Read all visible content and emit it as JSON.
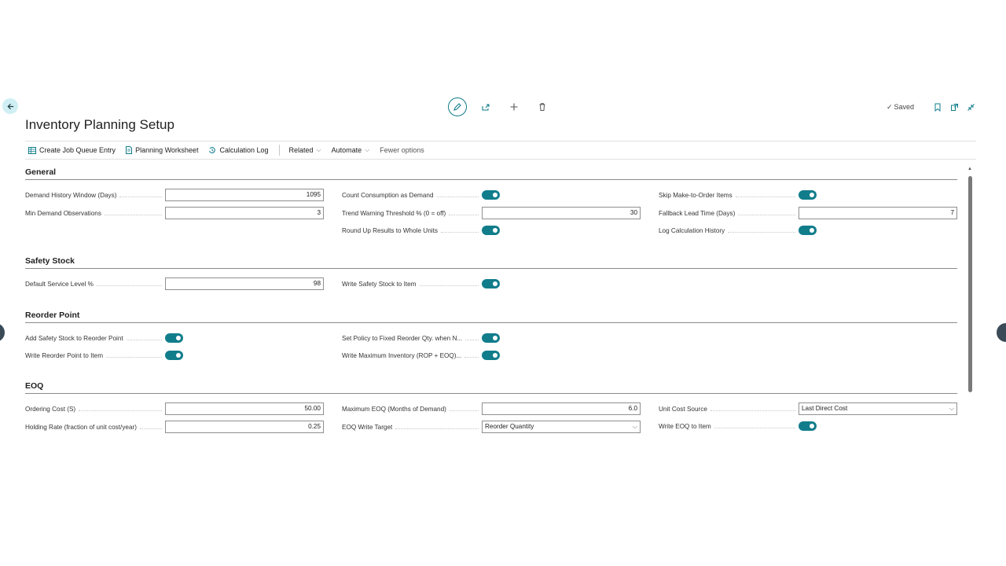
{
  "page": {
    "title": "Inventory Planning Setup",
    "status": "Saved"
  },
  "top_actions": [
    "edit-icon",
    "share-icon",
    "plus-icon",
    "delete-icon"
  ],
  "right_actions": [
    "bookmark-icon",
    "open-in-new-window-icon",
    "collapse-icon"
  ],
  "action_bar": {
    "create_job_queue": "Create Job Queue Entry",
    "planning_worksheet": "Planning Worksheet",
    "calculation_log": "Calculation Log",
    "related": "Related",
    "automate": "Automate",
    "fewer_options": "Fewer options"
  },
  "general": {
    "title": "General",
    "demand_history_window_label": "Demand History Window (Days)",
    "demand_history_window_value": "1095",
    "min_demand_observations_label": "Min Demand Observations",
    "min_demand_observations_value": "3",
    "count_consumption_label": "Count Consumption as Demand",
    "count_consumption_value": true,
    "trend_warning_label": "Trend Warning Threshold % (0 = off)",
    "trend_warning_value": "30",
    "round_up_label": "Round Up Results to Whole Units",
    "round_up_value": true,
    "skip_mto_label": "Skip Make-to-Order Items",
    "skip_mto_value": true,
    "fallback_lead_time_label": "Fallback Lead Time (Days)",
    "fallback_lead_time_value": "7",
    "log_history_label": "Log Calculation History",
    "log_history_value": true
  },
  "safety_stock": {
    "title": "Safety Stock",
    "service_level_label": "Default Service Level %",
    "service_level_value": "98",
    "write_safety_stock_label": "Write Safety Stock to Item",
    "write_safety_stock_value": true
  },
  "reorder_point": {
    "title": "Reorder Point",
    "add_safety_stock_label": "Add Safety Stock to Reorder Point",
    "add_safety_stock_value": true,
    "write_rop_label": "Write Reorder Point to Item",
    "write_rop_value": true,
    "set_policy_label": "Set Policy to Fixed Reorder Qty. when N...",
    "set_policy_value": true,
    "write_max_inventory_label": "Write Maximum Inventory (ROP + EOQ)...",
    "write_max_inventory_value": true
  },
  "eoq": {
    "title": "EOQ",
    "ordering_cost_label": "Ordering Cost (S)",
    "ordering_cost_value": "50.00",
    "holding_rate_label": "Holding Rate (fraction of unit cost/year)",
    "holding_rate_value": "0.25",
    "max_eoq_label": "Maximum EOQ (Months of Demand)",
    "max_eoq_value": "6.0",
    "eoq_write_target_label": "EOQ Write Target",
    "eoq_write_target_value": "Reorder Quantity",
    "unit_cost_source_label": "Unit Cost Source",
    "unit_cost_source_value": "Last Direct Cost",
    "write_eoq_label": "Write EOQ to Item",
    "write_eoq_value": true
  }
}
